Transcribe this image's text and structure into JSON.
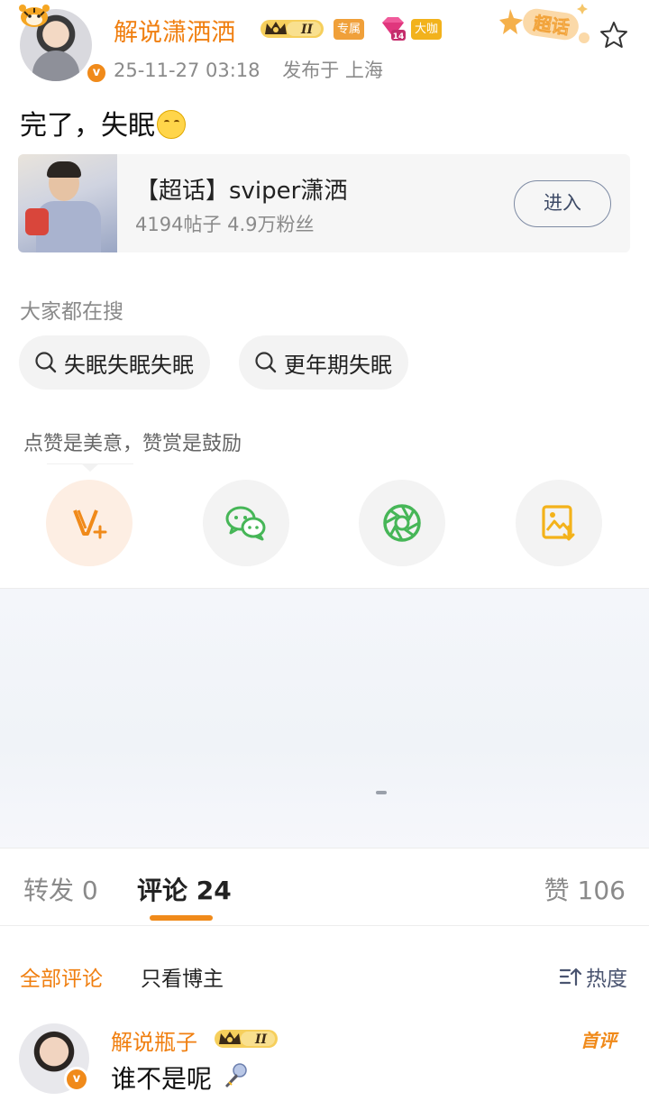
{
  "post": {
    "username": "解说潇洒洒",
    "tag_exclusive": "专属",
    "tag_bigshot": "大咖",
    "crown_level": "II",
    "gem_level": "14",
    "chaohua_logo_text": "超话",
    "timestamp": "25-11-27 03:18",
    "location": "发布于 上海",
    "content": "完了，失眠"
  },
  "topic_card": {
    "title": "【超话】sviper潇洒",
    "stats": "4194帖子 4.9万粉丝",
    "enter_label": "进入"
  },
  "search": {
    "heading": "大家都在搜",
    "suggestions": [
      "失眠失眠失眠",
      "更年期失眠"
    ]
  },
  "reward": {
    "tooltip": "点赞是美意，赞赏是鼓励"
  },
  "tabs": {
    "repost": "转发 0",
    "comment": "评论 24",
    "like": "赞 106"
  },
  "filters": {
    "all": "全部评论",
    "owner_only": "只看博主",
    "sort": "热度"
  },
  "comment": {
    "username": "解说瓶子",
    "crown_level": "II",
    "text": "谁不是呢",
    "badge": "首评"
  },
  "colors": {
    "accent_orange": "#f07f10",
    "wechat_green": "#46b657",
    "moments_green": "#46b657",
    "save_yellow": "#f3b21a"
  }
}
